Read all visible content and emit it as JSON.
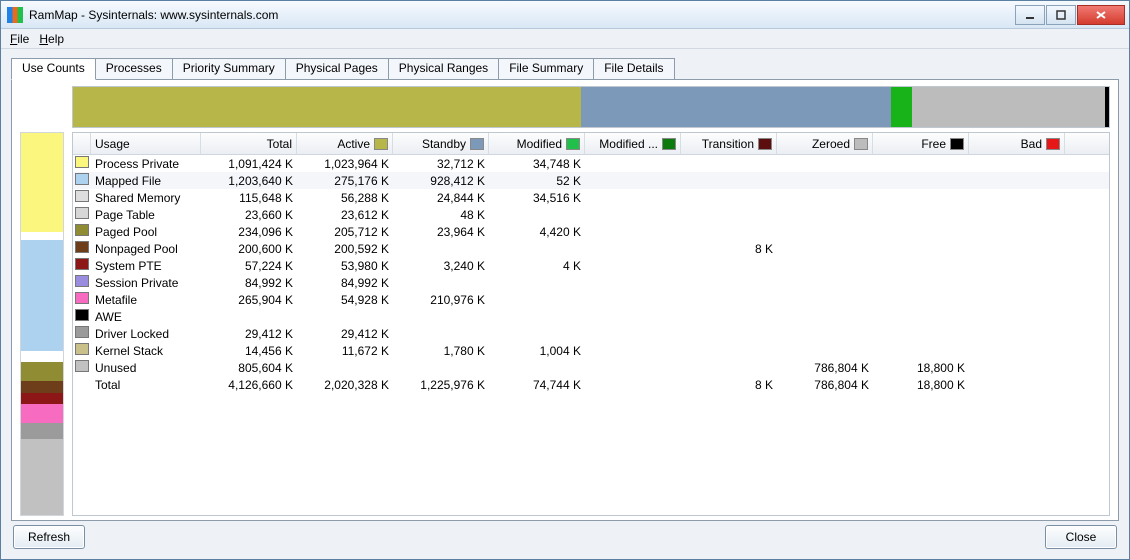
{
  "window": {
    "title": "RamMap - Sysinternals: www.sysinternals.com"
  },
  "menu": {
    "file": "File",
    "help": "Help"
  },
  "tabs": {
    "items": [
      "Use Counts",
      "Processes",
      "Priority Summary",
      "Physical Pages",
      "Physical Ranges",
      "File Summary",
      "File Details"
    ],
    "active": 0
  },
  "buttons": {
    "refresh": "Refresh",
    "close": "Close"
  },
  "topbar_segments": [
    {
      "color": "#b6b748",
      "pct": 49
    },
    {
      "color": "#7c99b9",
      "pct": 30
    },
    {
      "color": "#18b318",
      "pct": 2
    },
    {
      "color": "#bcbcbc",
      "pct": 18.6
    },
    {
      "color": "#000000",
      "pct": 0.4
    }
  ],
  "leftbar_segments": [
    {
      "color": "#fbf77e",
      "pct": 26
    },
    {
      "color": "#ffffff",
      "pct": 2
    },
    {
      "color": "#acd2f0",
      "pct": 29
    },
    {
      "color": "#ffffff",
      "pct": 3
    },
    {
      "color": "#8f8c33",
      "pct": 5
    },
    {
      "color": "#6e3d19",
      "pct": 3
    },
    {
      "color": "#8d1717",
      "pct": 3
    },
    {
      "color": "#f76bc1",
      "pct": 5
    },
    {
      "color": "#9b9b9b",
      "pct": 4
    },
    {
      "color": "#c1c1c1",
      "pct": 20
    }
  ],
  "columns": [
    {
      "label": "Usage",
      "color": null
    },
    {
      "label": "Total",
      "color": null
    },
    {
      "label": "Active",
      "color": "#b6b748"
    },
    {
      "label": "Standby",
      "color": "#7c99b9"
    },
    {
      "label": "Modified",
      "color": "#21c04a"
    },
    {
      "label": "Modified ...",
      "color": "#0c7a0c"
    },
    {
      "label": "Transition",
      "color": "#5c0d0d"
    },
    {
      "label": "Zeroed",
      "color": "#bcbcbc"
    },
    {
      "label": "Free",
      "color": "#000000"
    },
    {
      "label": "Bad",
      "color": "#e81717"
    }
  ],
  "rows": [
    {
      "sw": "#fbf77e",
      "alt": false,
      "usage": "Process Private",
      "total": "1,091,424 K",
      "active": "1,023,964 K",
      "standby": "32,712 K",
      "modified": "34,748 K",
      "modno": "",
      "trans": "",
      "zeroed": "",
      "free": "",
      "bad": ""
    },
    {
      "sw": "#acd2f0",
      "alt": true,
      "usage": "Mapped File",
      "total": "1,203,640 K",
      "active": "275,176 K",
      "standby": "928,412 K",
      "modified": "52 K",
      "modno": "",
      "trans": "",
      "zeroed": "",
      "free": "",
      "bad": ""
    },
    {
      "sw": "#dedede",
      "alt": false,
      "usage": "Shared Memory",
      "total": "115,648 K",
      "active": "56,288 K",
      "standby": "24,844 K",
      "modified": "34,516 K",
      "modno": "",
      "trans": "",
      "zeroed": "",
      "free": "",
      "bad": ""
    },
    {
      "sw": "#d7d7d7",
      "alt": false,
      "usage": "Page Table",
      "total": "23,660 K",
      "active": "23,612 K",
      "standby": "48 K",
      "modified": "",
      "modno": "",
      "trans": "",
      "zeroed": "",
      "free": "",
      "bad": ""
    },
    {
      "sw": "#8f8c33",
      "alt": false,
      "usage": "Paged Pool",
      "total": "234,096 K",
      "active": "205,712 K",
      "standby": "23,964 K",
      "modified": "4,420 K",
      "modno": "",
      "trans": "",
      "zeroed": "",
      "free": "",
      "bad": ""
    },
    {
      "sw": "#6e3d19",
      "alt": false,
      "usage": "Nonpaged Pool",
      "total": "200,600 K",
      "active": "200,592 K",
      "standby": "",
      "modified": "",
      "modno": "",
      "trans": "8 K",
      "zeroed": "",
      "free": "",
      "bad": ""
    },
    {
      "sw": "#8d1717",
      "alt": false,
      "usage": "System PTE",
      "total": "57,224 K",
      "active": "53,980 K",
      "standby": "3,240 K",
      "modified": "4 K",
      "modno": "",
      "trans": "",
      "zeroed": "",
      "free": "",
      "bad": ""
    },
    {
      "sw": "#9a8de0",
      "alt": false,
      "usage": "Session Private",
      "total": "84,992 K",
      "active": "84,992 K",
      "standby": "",
      "modified": "",
      "modno": "",
      "trans": "",
      "zeroed": "",
      "free": "",
      "bad": ""
    },
    {
      "sw": "#f76bc1",
      "alt": false,
      "usage": "Metafile",
      "total": "265,904 K",
      "active": "54,928 K",
      "standby": "210,976 K",
      "modified": "",
      "modno": "",
      "trans": "",
      "zeroed": "",
      "free": "",
      "bad": ""
    },
    {
      "sw": "#000000",
      "alt": false,
      "usage": "AWE",
      "total": "",
      "active": "",
      "standby": "",
      "modified": "",
      "modno": "",
      "trans": "",
      "zeroed": "",
      "free": "",
      "bad": ""
    },
    {
      "sw": "#9b9b9b",
      "alt": false,
      "usage": "Driver Locked",
      "total": "29,412 K",
      "active": "29,412 K",
      "standby": "",
      "modified": "",
      "modno": "",
      "trans": "",
      "zeroed": "",
      "free": "",
      "bad": ""
    },
    {
      "sw": "#c9c08a",
      "alt": false,
      "usage": "Kernel Stack",
      "total": "14,456 K",
      "active": "11,672 K",
      "standby": "1,780 K",
      "modified": "1,004 K",
      "modno": "",
      "trans": "",
      "zeroed": "",
      "free": "",
      "bad": ""
    },
    {
      "sw": "#c1c1c1",
      "alt": false,
      "usage": "Unused",
      "total": "805,604 K",
      "active": "",
      "standby": "",
      "modified": "",
      "modno": "",
      "trans": "",
      "zeroed": "786,804 K",
      "free": "18,800 K",
      "bad": ""
    },
    {
      "sw": null,
      "alt": false,
      "usage": "Total",
      "total": "4,126,660 K",
      "active": "2,020,328 K",
      "standby": "1,225,976 K",
      "modified": "74,744 K",
      "modno": "",
      "trans": "8 K",
      "zeroed": "786,804 K",
      "free": "18,800 K",
      "bad": ""
    }
  ]
}
